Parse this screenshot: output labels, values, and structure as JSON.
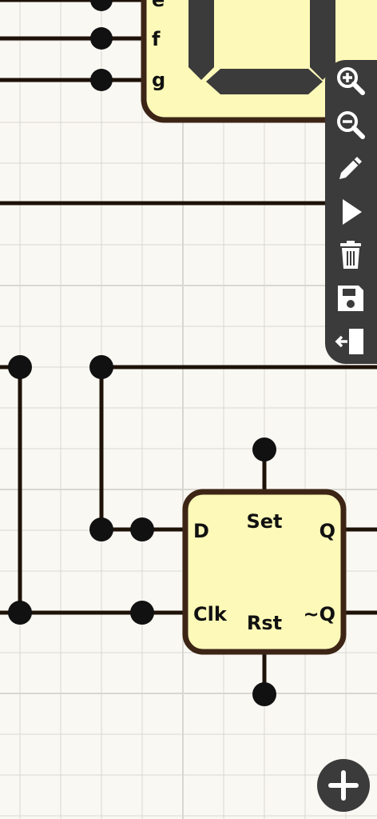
{
  "theme": {
    "background": "#faf8f3",
    "grid": "#d9d7d2",
    "wire": "#1e1208",
    "component_fill": "#fdf9b8",
    "component_border": "#3d2516",
    "toolbar": "#3b3b3b",
    "segment": "#3b3b3b"
  },
  "display": {
    "pins": {
      "e": "e",
      "f": "f",
      "g": "g"
    }
  },
  "flipflop": {
    "d": "D",
    "clk": "Clk",
    "set": "Set",
    "rst": "Rst",
    "q": "Q",
    "nq": "~Q"
  },
  "toolbar": {
    "icons": [
      "zoom-in-icon",
      "zoom-out-icon",
      "pencil-icon",
      "play-icon",
      "trash-icon",
      "save-icon",
      "exit-icon"
    ]
  },
  "fab": {
    "icon": "plus-icon"
  }
}
